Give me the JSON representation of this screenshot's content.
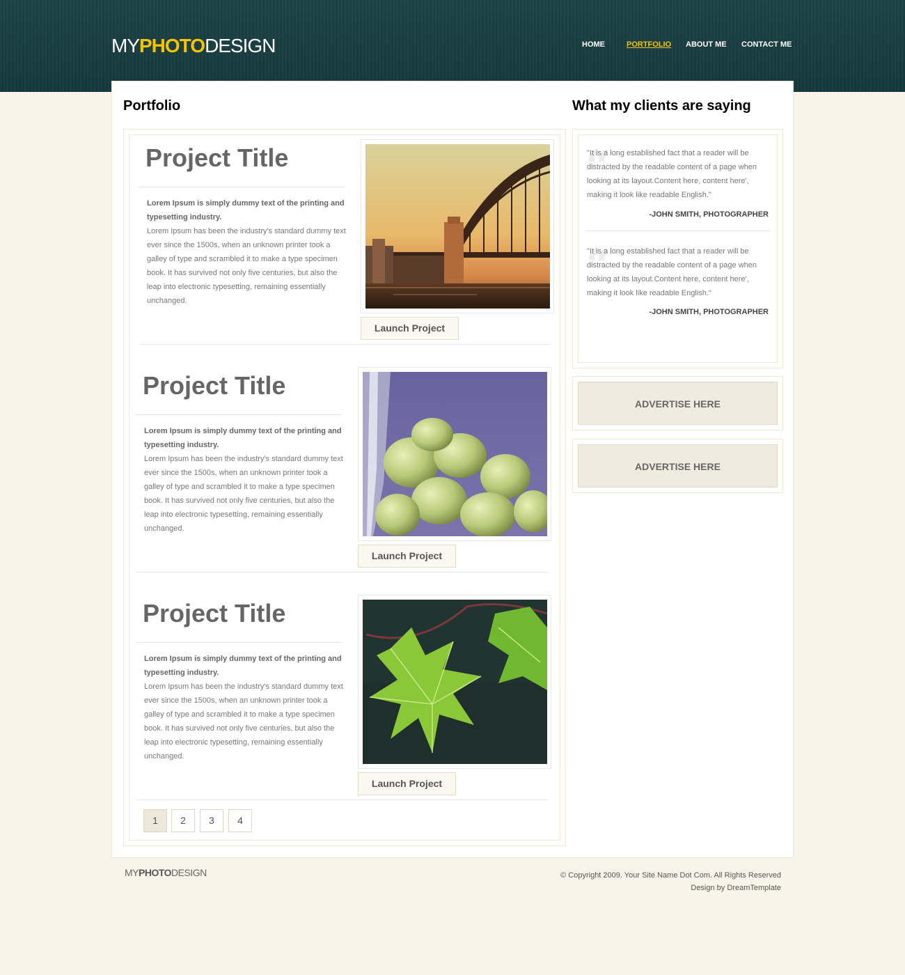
{
  "header": {
    "logo": {
      "part1": "MY",
      "part2": "PHOTO",
      "part3": "DESIGN"
    },
    "nav": [
      {
        "label": "HOME",
        "active": false
      },
      {
        "label": "PORTFOLIO",
        "active": true
      },
      {
        "label": "ABOUT ME",
        "active": false
      },
      {
        "label": "CONTACT ME",
        "active": false
      }
    ]
  },
  "main": {
    "portfolio_heading": "Portfolio",
    "projects": [
      {
        "title": "Project Title",
        "lead": "Lorem Ipsum is simply dummy text of the printing and typesetting industry.",
        "body": "Lorem Ipsum has been the industry's standard dummy text ever since the 1500s, when an unknown printer took a galley of type and scrambled it to make a type specimen book. It has survived not only five centuries, but also the leap into electronic typesetting, remaining essentially unchanged.",
        "image": "bridge-sunset",
        "button": "Launch Project"
      },
      {
        "title": "Project Title",
        "lead": "Lorem Ipsum is simply dummy text of the printing and typesetting industry.",
        "body": "Lorem Ipsum has been the industry's standard dummy text ever since the 1500s, when an unknown printer took a galley of type and scrambled it to make a type specimen book. It has survived not only five centuries, but also the leap into electronic typesetting, remaining essentially unchanged.",
        "image": "green-grapes",
        "button": "Launch Project"
      },
      {
        "title": "Project Title",
        "lead": "Lorem Ipsum is simply dummy text of the printing and typesetting industry.",
        "body": "Lorem Ipsum has been the industry's standard dummy text ever since the 1500s, when an unknown printer took a galley of type and scrambled it to make a type specimen book. It has survived not only five centuries, but also the leap into electronic typesetting, remaining essentially unchanged.",
        "image": "maple-leaf",
        "button": "Launch Project"
      }
    ],
    "pagination": [
      {
        "label": "1",
        "active": true
      },
      {
        "label": "2",
        "active": false
      },
      {
        "label": "3",
        "active": false
      },
      {
        "label": "4",
        "active": false
      }
    ]
  },
  "sidebar": {
    "heading": "What my clients are saying",
    "testimonials": [
      {
        "text": "\"It is a long established fact that a reader will be distracted by the readable content of a page when looking at its layout.Content here, content here', making it look like readable English.\"",
        "author": "-JOHN SMITH, PHOTOGRAPHER"
      },
      {
        "text": "\"It is a long established fact that a reader will be distracted by the readable content of a page when looking at its layout.Content here, content here', making it look like readable English.\"",
        "author": "-JOHN SMITH, PHOTOGRAPHER"
      }
    ],
    "ads": [
      "ADVERTISE HERE",
      "ADVERTISE HERE"
    ]
  },
  "footer": {
    "logo": {
      "part1": "MY",
      "part2": "PHOTO",
      "part3": "DESIGN"
    },
    "copyright": "© Copyright 2009. Your Site Name Dot Com. All Rights Reserved",
    "credit": "Design by DreamTemplate"
  },
  "colors": {
    "header_bg": "#1d4448",
    "accent": "#f5c400",
    "page_bg": "#f8f4ea",
    "ad_bg": "#efebdf"
  }
}
